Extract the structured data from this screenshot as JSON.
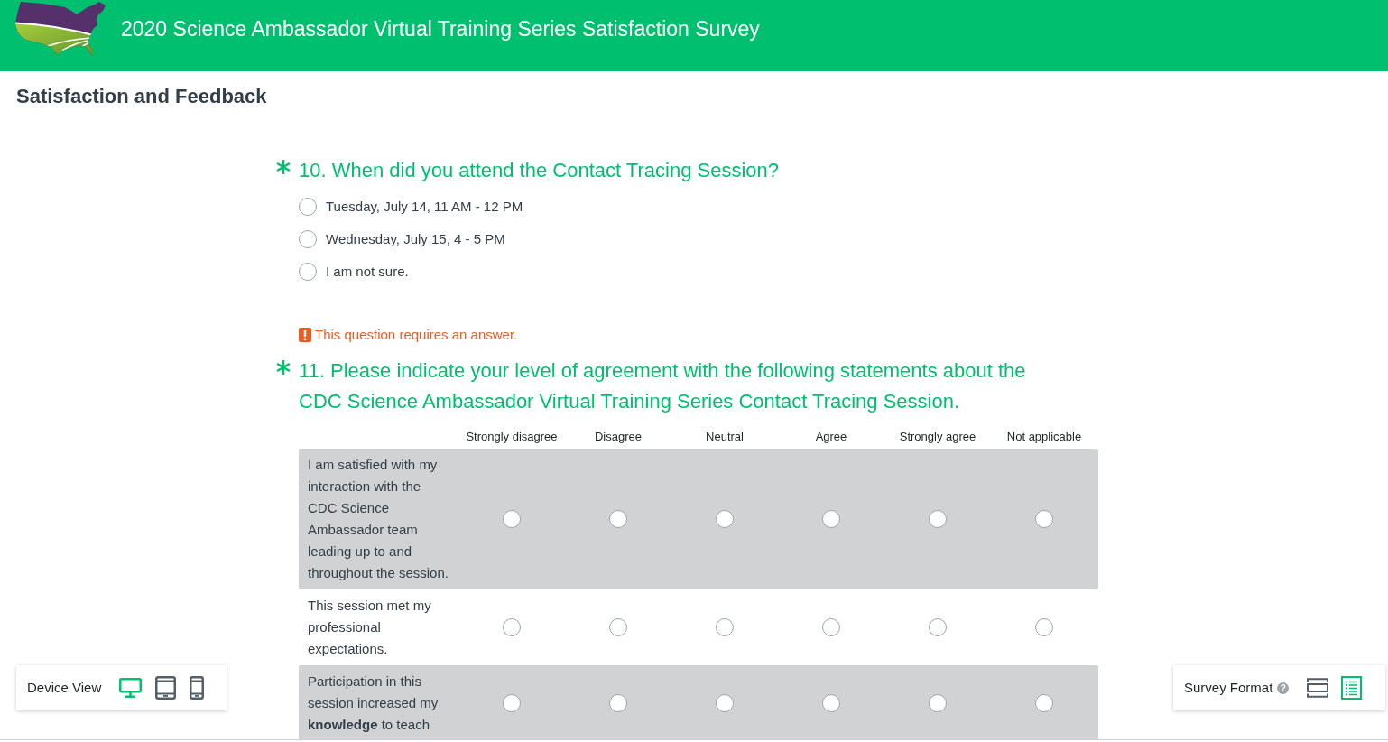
{
  "header": {
    "title": "2020 Science Ambassador Virtual Training Series Satisfaction Survey"
  },
  "page_title": "Satisfaction and Feedback",
  "questions": [
    {
      "kind": "single_choice",
      "required": true,
      "title": "10. When did you attend the Contact Tracing Session?",
      "options": [
        {
          "label": "Tuesday, July 14, 11 AM - 12 PM",
          "selected": false
        },
        {
          "label": "Wednesday, July 15, 4 - 5 PM",
          "selected": false
        },
        {
          "label": "I am not sure.",
          "selected": false
        }
      ]
    },
    {
      "kind": "matrix",
      "required": true,
      "error": "This question requires an answer.",
      "title": "11. Please indicate your level of agreement with the following statements about the CDC Science Ambassador Virtual Training Series Contact Tracing Session.",
      "columns": [
        "Strongly disagree",
        "Disagree",
        "Neutral",
        "Agree",
        "Strongly agree",
        "Not applicable"
      ],
      "rows": [
        {
          "statement": "I am satisfied with my interaction with the CDC Science Ambassador team leading up to and throughout the session.",
          "choices": [
            {
              "selected": false
            },
            {
              "selected": false
            },
            {
              "selected": false
            },
            {
              "selected": false
            },
            {
              "selected": false
            },
            {
              "selected": false
            }
          ]
        },
        {
          "statement": "This session met my professional expectations.",
          "choices": [
            {
              "selected": false
            },
            {
              "selected": false
            },
            {
              "selected": false
            },
            {
              "selected": false
            },
            {
              "selected": false
            },
            {
              "selected": false
            }
          ]
        },
        {
          "statement": "Participation in this session increased my **knowledge** to teach",
          "choices": [
            {
              "selected": false
            },
            {
              "selected": false
            },
            {
              "selected": false
            },
            {
              "selected": false
            },
            {
              "selected": false
            },
            {
              "selected": false
            }
          ]
        }
      ]
    }
  ],
  "device_view": {
    "label": "Device View",
    "devices": [
      {
        "kind": "desktop",
        "selected": true
      },
      {
        "kind": "tablet",
        "selected": false
      },
      {
        "kind": "phone",
        "selected": false
      }
    ]
  },
  "survey_format": {
    "label": "Survey Format",
    "help": "?",
    "formats": [
      {
        "kind": "one_at_a_time",
        "selected": false
      },
      {
        "kind": "scrolling_list",
        "selected": true
      }
    ]
  }
}
